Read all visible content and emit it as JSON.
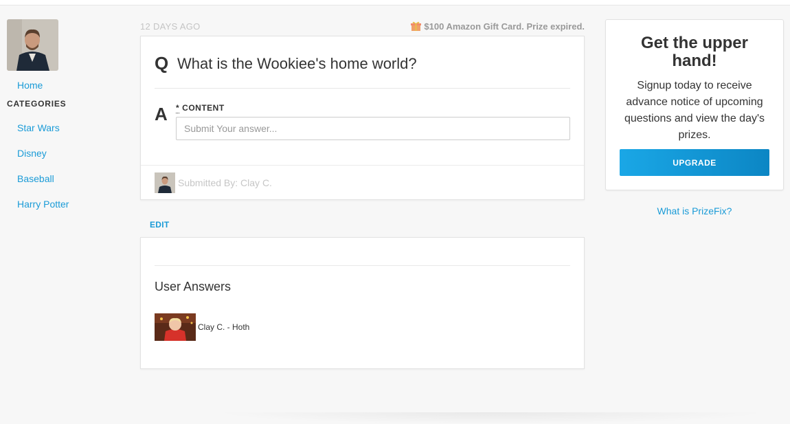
{
  "sidebar": {
    "home_label": "Home",
    "categories_heading": "CATEGORIES",
    "categories": [
      "Star Wars",
      "Disney",
      "Baseball",
      "Harry Potter"
    ]
  },
  "question": {
    "age": "12 DAYS AGO",
    "prize": "$100 Amazon Gift Card. Prize expired.",
    "q_letter": "Q",
    "text": "What is the Wookiee's home world?",
    "a_letter": "A",
    "required_mark": "*",
    "content_label": "CONTENT",
    "answer_placeholder": "Submit Your answer...",
    "submitted_by": "Submitted By: Clay C."
  },
  "edit_label": "EDIT",
  "answers": {
    "title": "User Answers",
    "items": [
      {
        "text": "Clay C. - Hoth"
      }
    ]
  },
  "promo": {
    "title": "Get the upper hand!",
    "body": "Signup today to receive advance notice of upcoming questions and view the day's prizes.",
    "button_label": "UPGRADE",
    "link": "What is PrizeFix?"
  },
  "colors": {
    "accent": "#1a9bd7",
    "button": "#0d8fd1",
    "background": "#f7f7f7"
  }
}
